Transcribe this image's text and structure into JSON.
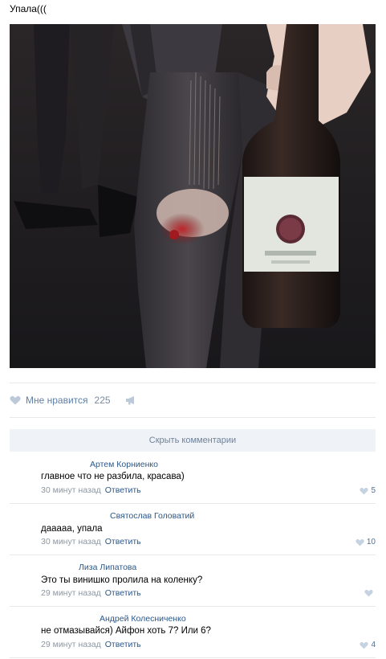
{
  "post": {
    "text": "Упала((("
  },
  "actions": {
    "like_label": "Мне нравится",
    "like_count": "225"
  },
  "comments_toggle": "Скрыть комментарии",
  "comments": [
    {
      "author": "Артем Корниенко",
      "text": "главное что не разбила, красава)",
      "time": "30 минут назад",
      "reply": "Ответить",
      "likes": "5"
    },
    {
      "author": "Святослав Головатий",
      "text": "дааааа, упала",
      "time": "30 минут назад",
      "reply": "Ответить",
      "likes": "10"
    },
    {
      "author": "Лиза Липатова",
      "text": "Это ты винишко пролила на коленку?",
      "time": "29 минут назад",
      "reply": "Ответить",
      "likes": ""
    },
    {
      "author": "Андрей Колесниченко",
      "text": "не отмазывайся) Айфон хоть 7? Или 6?",
      "time": "29 минут назад",
      "reply": "Ответить",
      "likes": "4"
    }
  ],
  "colors": {
    "link": "#2b5788",
    "muted": "#8c97a3",
    "separator": "#e7e8ec",
    "button_bg": "#eff2f6"
  },
  "icons": {
    "like": "heart-icon",
    "share": "megaphone-icon",
    "comment_like": "heart-icon"
  }
}
